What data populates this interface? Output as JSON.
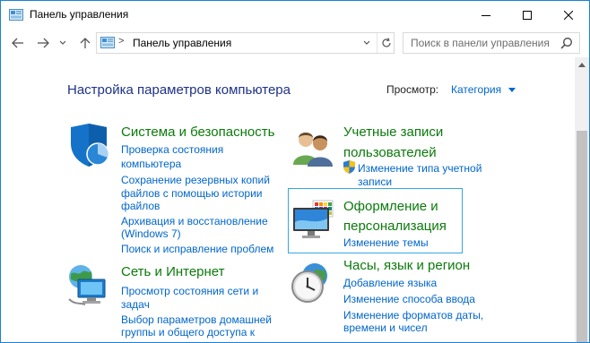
{
  "window": {
    "title": "Панель управления",
    "accent_color": "#1883d7"
  },
  "toolbar": {
    "back_icon": "arrow-left-icon",
    "forward_icon": "arrow-right-icon",
    "recent_icon": "chevron-down-icon",
    "up_icon": "arrow-up-icon"
  },
  "address": {
    "separator": ">",
    "path": "Панель управления"
  },
  "search": {
    "placeholder": "Поиск в панели управления"
  },
  "main": {
    "heading": "Настройка параметров компьютера",
    "view_by_label": "Просмотр:",
    "view_by_value": "Категория"
  },
  "categories": [
    {
      "title": "Система и безопасность",
      "icon": "shield-security-icon",
      "links": [
        "Проверка состояния",
        "компьютера",
        "Сохранение резервных копий",
        "файлов с помощью истории",
        "файлов",
        "Архивация и восстановление",
        "(Windows 7)",
        "Поиск и исправление проблем"
      ]
    },
    {
      "title": "Сеть и Интернет",
      "icon": "network-icon",
      "links": [
        "Просмотр состояния сети и",
        "задач",
        "Выбор параметров домашней",
        "группы и общего доступа к"
      ]
    },
    {
      "title_lines": [
        "Учетные записи",
        "пользователей"
      ],
      "icon": "users-icon",
      "links": [
        "Изменение типа учетной",
        "записи"
      ],
      "link_icon": "uac-shield-icon"
    },
    {
      "title_lines": [
        "Оформление и",
        "персонализация"
      ],
      "icon": "display-personalization-icon",
      "links": [
        "Изменение темы"
      ]
    },
    {
      "title": "Часы, язык и регион",
      "icon": "clock-globe-icon",
      "links": [
        "Добавление языка",
        "Изменение способа ввода",
        "Изменение форматов даты,",
        "времени и чисел"
      ]
    }
  ]
}
